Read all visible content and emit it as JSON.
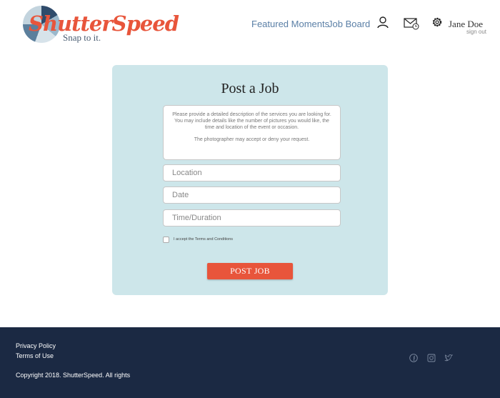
{
  "brand": {
    "name": "ShutterSpeed",
    "tagline": "Snap to it."
  },
  "nav": {
    "featured_moments": "Featured Moments",
    "job_board": "Job Board",
    "user_name": "Jane Doe",
    "sign_out": "sign out",
    "icons": [
      "user-icon",
      "mail-icon",
      "gear-icon"
    ]
  },
  "form": {
    "title": "Post a Job",
    "description_placeholder": {
      "line1": "Please provide a detailed description of the services you are looking for.",
      "line2": "You may include details like the number of pictures you would like, the time and location of the event or occasion.",
      "line3": "The photographer may accept or deny your request."
    },
    "location_placeholder": "Location",
    "date_placeholder": "Date",
    "time_placeholder": "Time/Duration",
    "terms_label": "I accept the Terms and Conditions",
    "terms_checked": false,
    "submit_label": "POST JOB"
  },
  "footer": {
    "privacy": "Privacy Policy",
    "terms": "Terms of Use",
    "copyright": "Copyright 2018. ShutterSpeed. All rights",
    "social": [
      "facebook-icon",
      "instagram-icon",
      "twitter-icon"
    ]
  },
  "colors": {
    "accent": "#e8553b",
    "card_bg": "#cde6ea",
    "footer_bg": "#1b2943",
    "nav_link": "#5a7fa6"
  }
}
